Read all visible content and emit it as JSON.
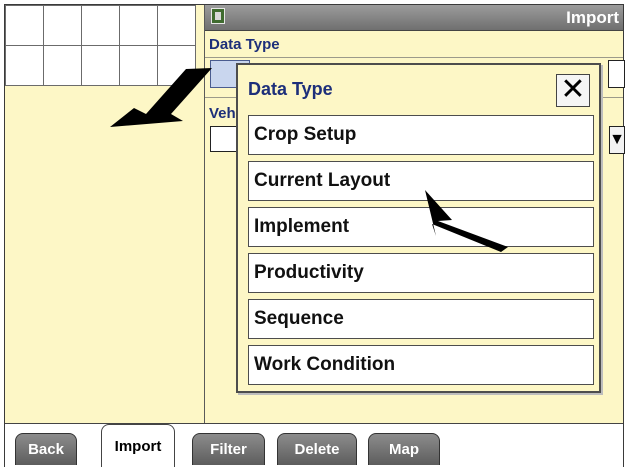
{
  "window": {
    "title": "Import"
  },
  "form": {
    "data_type_label": "Data Type",
    "vehicle_label": "Vehicle"
  },
  "dialog": {
    "title": "Data Type",
    "close_glyph": "✕",
    "options": [
      "Crop Setup",
      "Current Layout",
      "Implement",
      "Productivity",
      "Sequence",
      "Work Condition"
    ]
  },
  "tabs": [
    {
      "label": "Back",
      "active": false
    },
    {
      "label": "Import",
      "active": true
    },
    {
      "label": "Filter",
      "active": false
    },
    {
      "label": "Delete",
      "active": false
    },
    {
      "label": "Map",
      "active": false
    }
  ],
  "icons": {
    "title_icon": "import-app-icon",
    "dropdown_icon": "triangle-down-icon",
    "close_icon": "close-icon"
  },
  "colors": {
    "background": "#fdf7c6",
    "label_text": "#1d2f7a",
    "tab_gray": "#6f6f6f"
  }
}
